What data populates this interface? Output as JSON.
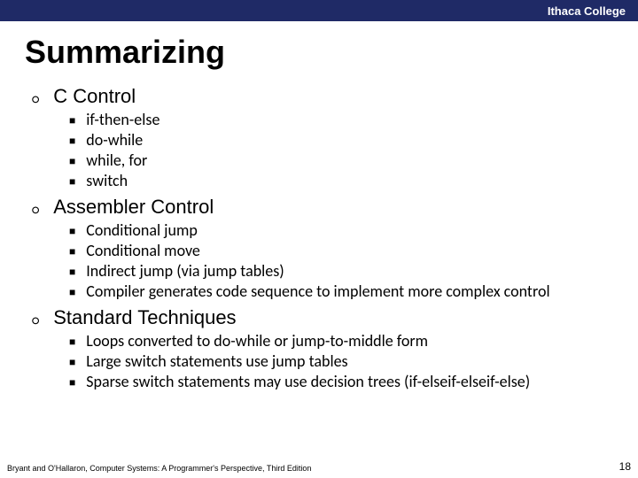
{
  "header": {
    "org": "Ithaca College"
  },
  "title": "Summarizing",
  "sections": {
    "0": {
      "title": "C Control",
      "items": {
        "0": "if-then-else",
        "1": "do-while",
        "2": "while, for",
        "3": "switch"
      }
    },
    "1": {
      "title": "Assembler Control",
      "items": {
        "0": "Conditional jump",
        "1": "Conditional move",
        "2": "Indirect jump (via jump tables)",
        "3": "Compiler generates code sequence to implement more complex control"
      }
    },
    "2": {
      "title": "Standard Techniques",
      "items": {
        "0": "Loops converted to do-while or jump-to-middle form",
        "1": "Large switch statements use jump tables",
        "2": "Sparse switch statements may use decision trees (if-elseif-elseif-else)"
      }
    }
  },
  "footer": {
    "citation": "Bryant and O'Hallaron, Computer Systems: A Programmer's Perspective, Third Edition",
    "page": "18"
  }
}
